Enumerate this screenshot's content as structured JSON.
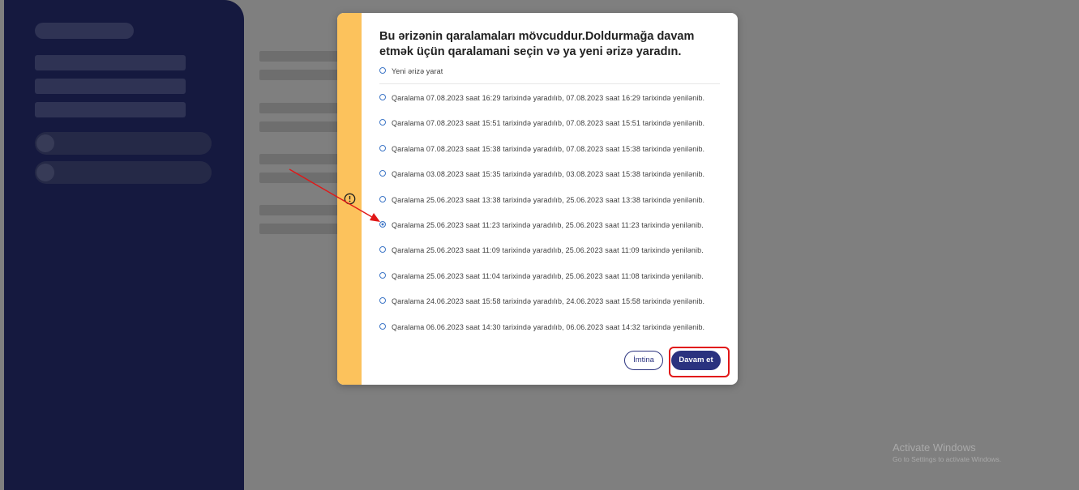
{
  "modal": {
    "title": "Bu ərizənin qaralamaları mövcuddur.Doldurmağa davam etmək üçün qaralamani seçin və ya yeni ərizə yaradın.",
    "new_option_label": "Yeni ərizə yarat",
    "drafts": [
      {
        "label": "Qaralama 07.08.2023 saat 16:29 tarixində yaradılıb, 07.08.2023 saat 16:29 tarixində yenilənib.",
        "selected": false
      },
      {
        "label": "Qaralama 07.08.2023 saat 15:51 tarixində yaradılıb, 07.08.2023 saat 15:51 tarixində yenilənib.",
        "selected": false
      },
      {
        "label": "Qaralama 07.08.2023 saat 15:38 tarixində yaradılıb, 07.08.2023 saat 15:38 tarixində yenilənib.",
        "selected": false
      },
      {
        "label": "Qaralama 03.08.2023 saat 15:35 tarixində yaradılıb, 03.08.2023 saat 15:38 tarixində yenilənib.",
        "selected": false
      },
      {
        "label": "Qaralama 25.06.2023 saat 13:38 tarixində yaradılıb, 25.06.2023 saat 13:38 tarixində yenilənib.",
        "selected": false
      },
      {
        "label": "Qaralama 25.06.2023 saat 11:23 tarixində yaradılıb, 25.06.2023 saat 11:23 tarixində yenilənib.",
        "selected": true
      },
      {
        "label": "Qaralama 25.06.2023 saat 11:09 tarixində yaradılıb, 25.06.2023 saat 11:09 tarixində yenilənib.",
        "selected": false
      },
      {
        "label": "Qaralama 25.06.2023 saat 11:04 tarixində yaradılıb, 25.06.2023 saat 11:08 tarixində yenilənib.",
        "selected": false
      },
      {
        "label": "Qaralama 24.06.2023 saat 15:58 tarixində yaradılıb, 24.06.2023 saat 15:58 tarixində yenilənib.",
        "selected": false
      },
      {
        "label": "Qaralama 06.06.2023 saat 14:30 tarixində yaradılıb, 06.06.2023 saat 14:32 tarixində yenilənib.",
        "selected": false
      }
    ],
    "cancel_label": "İmtina",
    "continue_label": "Davam et"
  },
  "watermark": {
    "title": "Activate Windows",
    "subtitle": "Go to Settings to activate Windows."
  },
  "colors": {
    "sidebar": "#2a327f",
    "accent_strip": "#fcc25c",
    "radio": "#3f77c7",
    "primary_button": "#2a327f",
    "annotation_red": "#e11717"
  },
  "icons": {
    "warning": "warning-circle-icon",
    "annotation_arrow": "red-arrow"
  }
}
